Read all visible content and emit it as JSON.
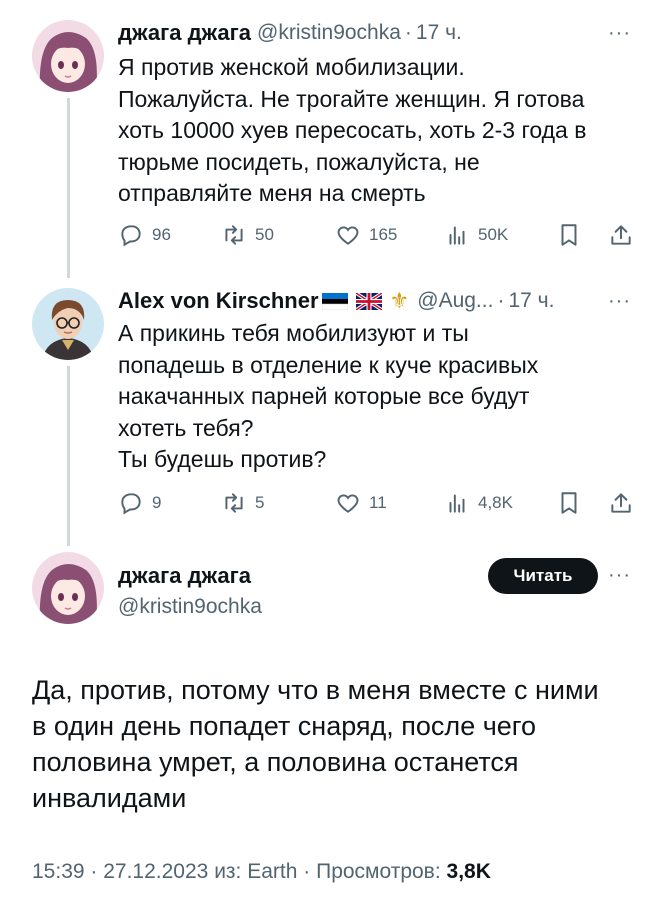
{
  "tweet1": {
    "display_name": "джага джага",
    "handle": "@kristin9ochka",
    "separator": "·",
    "time": "17 ч.",
    "more": "···",
    "text_lines": [
      "Я против женской мобилизации.",
      "Пожалуйста. Не трогайте женщин. Я готова",
      "хоть 10000 хуев пересосать, хоть 2-3 года в",
      "тюрьме посидеть, пожалуйста, не",
      "отправляйте меня на смерть"
    ],
    "actions": {
      "replies": "96",
      "retweets": "50",
      "likes": "165",
      "views": "50K"
    }
  },
  "tweet2": {
    "display_name": "Alex von Kirschner",
    "flags": [
      "estonia-flag",
      "uk-flag",
      "fleur-de-lis"
    ],
    "handle": "@Aug...",
    "separator": "·",
    "time": "17 ч.",
    "more": "···",
    "text_lines": [
      "А прикинь тебя мобилизуют и ты",
      "попадешь в отделение к куче красивых",
      "накачанных парней которые все будут",
      "хотеть тебя?",
      "Ты будешь против?"
    ],
    "actions": {
      "replies": "9",
      "retweets": "5",
      "likes": "11",
      "views": "4,8K"
    }
  },
  "main_tweet": {
    "display_name": "джага джага",
    "handle": "@kristin9ochka",
    "follow_label": "Читать",
    "more": "···",
    "text_lines": [
      "Да, против, потому что в меня вместе с ними",
      "в один день попадет снаряд, после чего",
      "половина умрет, а половина останется",
      "инвалидами"
    ],
    "footer": {
      "time": "15:39",
      "date": "27.12.2023",
      "source": "из: Earth",
      "views_label": "Просмотров:",
      "views_count": "3,8K"
    }
  },
  "colors": {
    "text": "#0f1419",
    "secondary": "#536471",
    "thread_line": "#cfd9de",
    "follow_bg": "#0f1419"
  }
}
